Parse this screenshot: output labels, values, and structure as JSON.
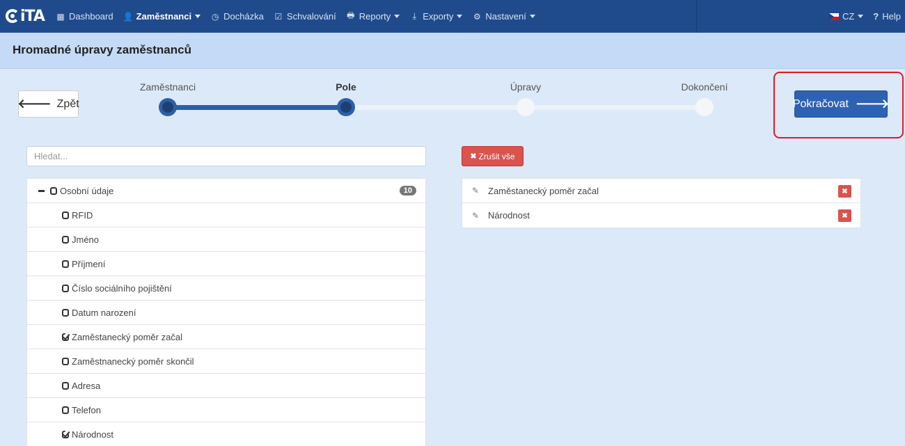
{
  "app": {
    "logo_text": "iTA"
  },
  "nav": {
    "items": [
      {
        "label": "Dashboard",
        "icon": "grid-icon",
        "glyph": "▦",
        "caret": false,
        "active": false
      },
      {
        "label": "Zaměstnanci",
        "icon": "user-icon",
        "glyph": "👤",
        "caret": true,
        "active": true
      },
      {
        "label": "Docházka",
        "icon": "clock-icon",
        "glyph": "◷",
        "caret": false,
        "active": false
      },
      {
        "label": "Schvalování",
        "icon": "check-square-icon",
        "glyph": "☑",
        "caret": false,
        "active": false
      },
      {
        "label": "Reporty",
        "icon": "printer-icon",
        "glyph": "🖶",
        "caret": true,
        "active": false
      },
      {
        "label": "Exporty",
        "icon": "download-icon",
        "glyph": "⤓",
        "caret": true,
        "active": false
      },
      {
        "label": "Nastavení",
        "icon": "gear-icon",
        "glyph": "⚙",
        "caret": true,
        "active": false
      }
    ],
    "language": "CZ",
    "help": "Help"
  },
  "page": {
    "title": "Hromadné úpravy zaměstnanců"
  },
  "wizard": {
    "back_label": "Zpět",
    "continue_label": "Pokračovat",
    "steps": [
      {
        "label": "Zaměstnanci",
        "state": "done"
      },
      {
        "label": "Pole",
        "state": "current"
      },
      {
        "label": "Úpravy",
        "state": "todo"
      },
      {
        "label": "Dokončení",
        "state": "todo"
      }
    ]
  },
  "search": {
    "placeholder": "Hledat...",
    "value": ""
  },
  "tree": {
    "group": {
      "label": "Osobní údaje",
      "count": "10",
      "checked": false
    },
    "fields": [
      {
        "label": "RFID",
        "checked": false
      },
      {
        "label": "Jméno",
        "checked": false
      },
      {
        "label": "Příjmení",
        "checked": false
      },
      {
        "label": "Číslo sociálního pojištění",
        "checked": false
      },
      {
        "label": "Datum narození",
        "checked": false
      },
      {
        "label": "Zaměstanecký poměr začal",
        "checked": true
      },
      {
        "label": "Zaměstnanecký poměr skončil",
        "checked": false
      },
      {
        "label": "Adresa",
        "checked": false
      },
      {
        "label": "Telefon",
        "checked": false
      },
      {
        "label": "Národnost",
        "checked": true
      }
    ]
  },
  "selected": {
    "cancel_all_label": "Zrušit vše",
    "items": [
      {
        "label": "Zaměstanecký poměr začal"
      },
      {
        "label": "Národnost"
      }
    ]
  },
  "colors": {
    "navbar": "#1f4b8d",
    "primary": "#2d62b3",
    "danger": "#d9534f",
    "highlight": "#e0191e"
  }
}
